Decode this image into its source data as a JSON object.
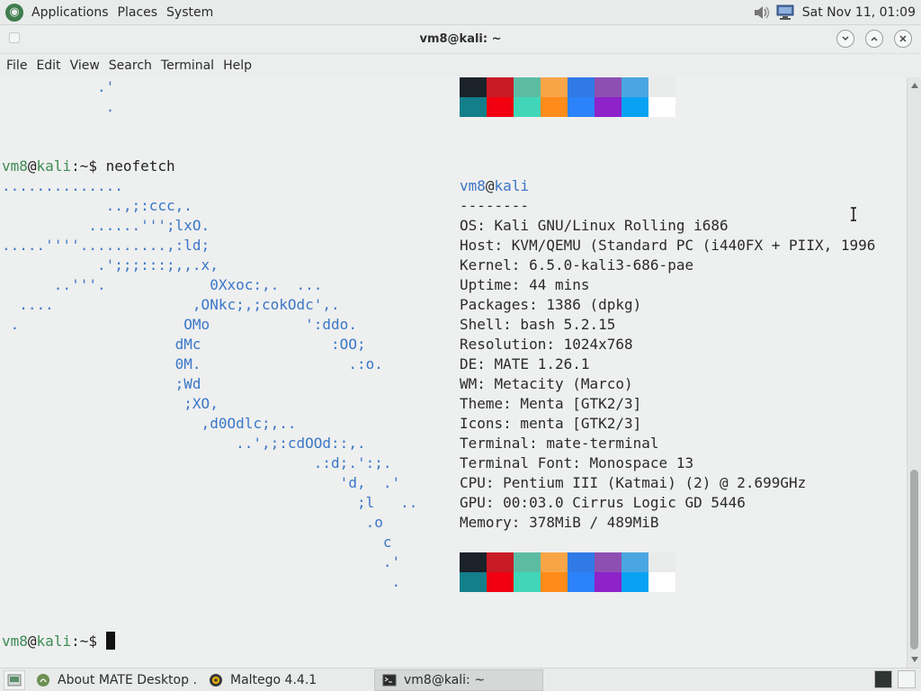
{
  "top_panel": {
    "menus": [
      "Applications",
      "Places",
      "System"
    ],
    "clock": "Sat Nov 11, 01:09",
    "icons": [
      "kali-menu-icon",
      "volume-icon",
      "network-icon"
    ]
  },
  "window": {
    "title": "vm8@kali: ~",
    "menu": [
      "File",
      "Edit",
      "View",
      "Search",
      "Terminal",
      "Help"
    ]
  },
  "terminal": {
    "prev_ascii_tail": [
      "           .'",
      "            ."
    ],
    "prompt_user": "vm8",
    "prompt_at": "@",
    "prompt_host": "kali",
    "prompt_path": ":~$ ",
    "command": "neofetch",
    "ascii": [
      "..............",
      "            ..,;:ccc,.",
      "          ......''';lxO.",
      ".....''''..........,:ld;",
      "           .';;;:::;,,.x,",
      "      ..'''.            0Xxoc:,.  ...",
      "  ....                ,ONkc;,;cokOdc',.",
      " .                   OMo           ':ddo.",
      "                    dMc               :OO;",
      "                    0M.                 .:o.",
      "                    ;Wd",
      "                     ;XO,",
      "                       ,d0Odlc;,..",
      "                           ..',;:cdOOd::,.",
      "                                    .:d;.':;.",
      "                                       'd,  .'",
      "                                         ;l   ..",
      "                                          .o",
      "                                            c",
      "                                            .'",
      "                                             ."
    ],
    "info_user": "vm8",
    "info_host": "kali",
    "separator": "--------",
    "info": [
      "OS: Kali GNU/Linux Rolling i686",
      "Host: KVM/QEMU (Standard PC (i440FX + PIIX, 1996",
      "Kernel: 6.5.0-kali3-686-pae",
      "Uptime: 44 mins",
      "Packages: 1386 (dpkg)",
      "Shell: bash 5.2.15",
      "Resolution: 1024x768",
      "DE: MATE 1.26.1",
      "WM: Metacity (Marco)",
      "Theme: Menta [GTK2/3]",
      "Icons: menta [GTK2/3]",
      "Terminal: mate-terminal",
      "Terminal Font: Monospace 13",
      "CPU: Pentium III (Katmai) (2) @ 2.699GHz",
      "GPU: 00:03.0 Cirrus Logic GD 5446",
      "Memory: 378MiB / 489MiB"
    ],
    "palette_top": [
      "#1b2229",
      "#c91b25",
      "#5cbca3",
      "#f8a548",
      "#2f7ae6",
      "#8e4fb2",
      "#4aa6e0",
      "#eaebeb"
    ],
    "palette_bottom": [
      "#137f8a",
      "#f20010",
      "#41d6b8",
      "#ff8c1a",
      "#2c82f8",
      "#8d23c9",
      "#09a2f3",
      "#ffffff"
    ]
  },
  "taskbar": {
    "tasks": [
      {
        "label": "About MATE Desktop ...",
        "icon": "mate-about-icon",
        "active": false
      },
      {
        "label": "Maltego 4.4.1",
        "icon": "maltego-icon",
        "active": false
      },
      {
        "label": "vm8@kali: ~",
        "icon": "terminal-icon",
        "active": true
      }
    ]
  }
}
